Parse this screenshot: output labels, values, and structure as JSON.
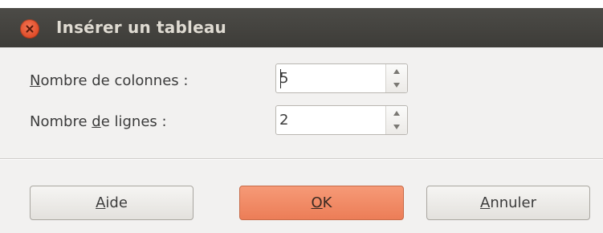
{
  "dialog": {
    "title": "Insérer un tableau",
    "close_icon": "close-icon"
  },
  "form": {
    "columns": {
      "label_mnemonic": "N",
      "label_rest": "ombre de colonnes :",
      "value": "5"
    },
    "rows": {
      "label_pre": "Nombre ",
      "label_mnemonic": "d",
      "label_rest": "e lignes :",
      "value": "2"
    }
  },
  "buttons": {
    "help": {
      "mnemonic": "A",
      "rest": "ide"
    },
    "ok": {
      "mnemonic": "O",
      "rest": "K"
    },
    "cancel": {
      "mnemonic": "A",
      "rest": "nnuler"
    }
  },
  "colors": {
    "titlebar": "#3d3c38",
    "close": "#df4a26",
    "ok_accent": "#ec7d57",
    "background": "#f2f1f0"
  }
}
